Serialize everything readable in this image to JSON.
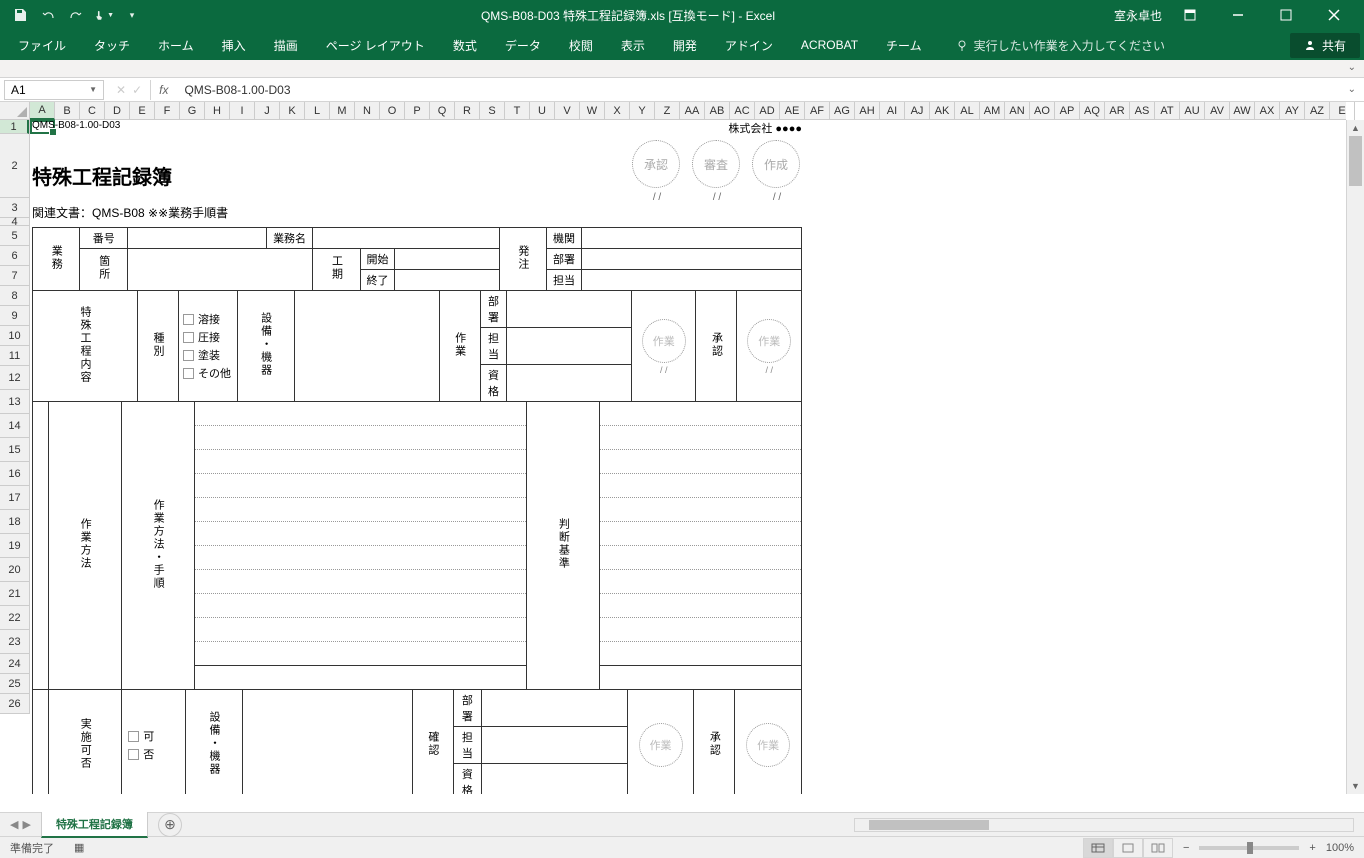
{
  "titlebar": {
    "title": "QMS-B08-D03 特殊工程記録簿.xls  [互換モード] - Excel",
    "user": "室永卓也"
  },
  "ribbon": {
    "tabs": [
      "ファイル",
      "タッチ",
      "ホーム",
      "挿入",
      "描画",
      "ページ レイアウト",
      "数式",
      "データ",
      "校閲",
      "表示",
      "開発",
      "アドイン",
      "ACROBAT",
      "チーム"
    ],
    "tell_me": "実行したい作業を入力してください",
    "share": "共有"
  },
  "namebox": {
    "cell": "A1"
  },
  "formula": {
    "value": "QMS-B08-1.00-D03"
  },
  "columns": [
    "A",
    "B",
    "C",
    "D",
    "E",
    "F",
    "G",
    "H",
    "I",
    "J",
    "K",
    "L",
    "M",
    "N",
    "O",
    "P",
    "Q",
    "R",
    "S",
    "T",
    "U",
    "V",
    "W",
    "X",
    "Y",
    "Z",
    "AA",
    "AB",
    "AC",
    "AD",
    "AE",
    "AF",
    "AG",
    "AH",
    "AI",
    "AJ",
    "AK",
    "AL",
    "AM",
    "AN",
    "AO",
    "AP",
    "AQ",
    "AR",
    "AS",
    "AT",
    "AU",
    "AV",
    "AW",
    "AX",
    "AY",
    "AZ",
    "E"
  ],
  "rows": [
    1,
    2,
    3,
    4,
    5,
    6,
    7,
    8,
    9,
    10,
    11,
    12,
    13,
    14,
    15,
    16,
    17,
    18,
    19,
    20,
    21,
    22,
    23,
    24,
    25,
    26
  ],
  "row_heights": {
    "1": 14,
    "2": 64,
    "3": 20,
    "4": 8,
    "5": 20,
    "6": 20,
    "7": 20,
    "8": 20,
    "9": 20,
    "10": 20,
    "11": 20,
    "12": 24,
    "13": 24,
    "14": 24,
    "15": 24,
    "16": 24,
    "17": 24,
    "18": 24,
    "19": 24,
    "20": 24,
    "21": 24,
    "22": 24,
    "23": 24,
    "24": 20,
    "25": 20,
    "26": 20
  },
  "doc": {
    "id": "QMS-B08-1.00-D03",
    "company": "株式会社 ●●●●",
    "title": "特殊工程記録簿",
    "ref": "関連文書：QMS-B08 ※※業務手順書",
    "stamps": [
      "承認",
      "審査",
      "作成"
    ],
    "stamp_date": "/    /",
    "labels": {
      "gyomu": "業務",
      "bango": "番号",
      "gyomumei": "業務名",
      "kasho": "箇所",
      "koki": "工期",
      "kaishi": "開始",
      "shuryo": "終了",
      "hacchu": "発注",
      "kikan": "機関",
      "busho": "部署",
      "tanto": "担当",
      "shubetsu": "種別",
      "setsubi": "設備・機器",
      "sagyo": "作業",
      "shikaku": "資格",
      "sagyo_stamp": "作業",
      "shonin": "承認",
      "date": "/   /",
      "tokushu": "特殊工程内容",
      "sagyohoho": "作業方法",
      "sagyohoho2": "作業方法・手順",
      "handan": "判断基準",
      "jisshi": "実施可否",
      "ka": "可",
      "hi": "否",
      "kakunin": "確認",
      "chk": [
        "溶接",
        "圧接",
        "塗装",
        "その他"
      ]
    }
  },
  "sheet_tab": "特殊工程記録簿",
  "statusbar": {
    "ready": "準備完了",
    "zoom": "100%"
  }
}
